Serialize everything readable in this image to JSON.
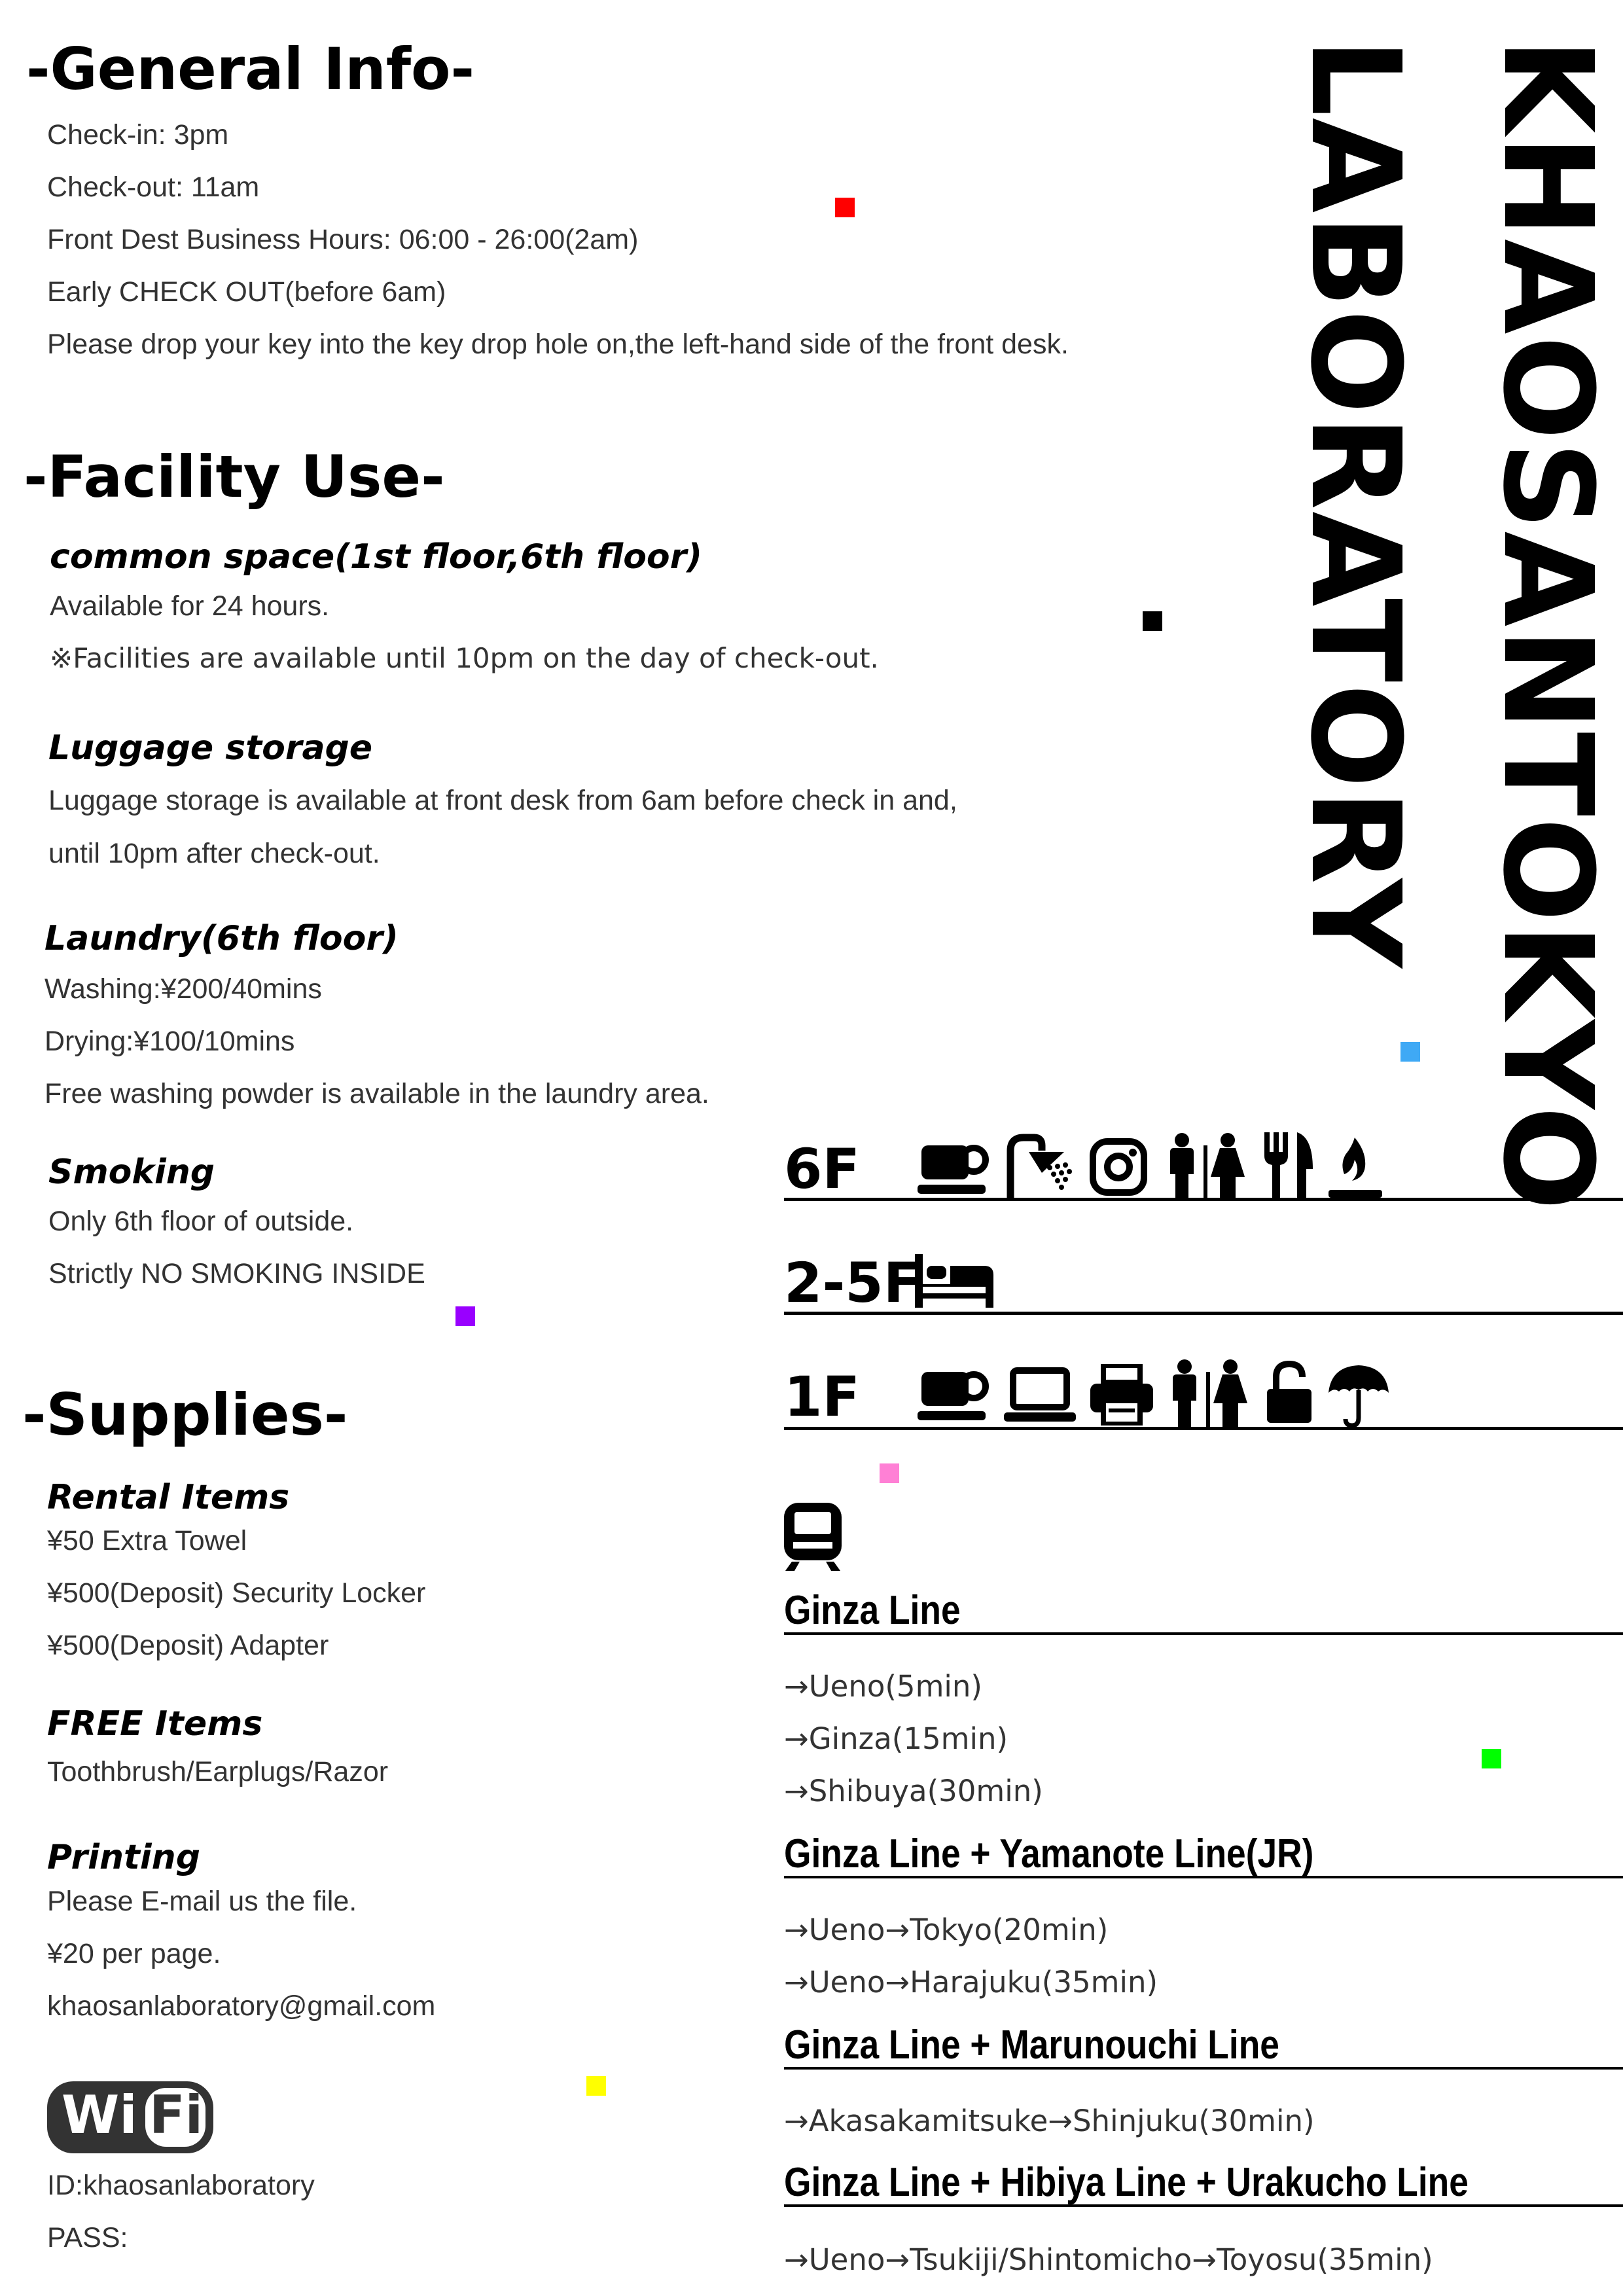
{
  "general": {
    "title": "-General Info-",
    "lines": [
      "Check-in: 3pm",
      "Check-out: 11am",
      "Front Dest Business Hours: 06:00 - 26:00(2am)",
      "Early CHECK OUT(before 6am)",
      "Please drop your key into the key drop hole on,the left-hand side of the front desk."
    ]
  },
  "facility": {
    "title": "-Facility Use-",
    "common": {
      "heading": "common space(1st floor,6th floor)",
      "lines": [
        "Available for 24 hours.",
        "※Facilities are available until 10pm on the day of check-out."
      ]
    },
    "luggage": {
      "heading": "Luggage storage",
      "lines": [
        "Luggage storage is available at front desk from 6am before check in and,",
        "until 10pm after check-out."
      ]
    },
    "laundry": {
      "heading": "Laundry(6th floor)",
      "lines": [
        "Washing:¥200/40mins",
        "Drying:¥100/10mins",
        "Free washing powder is available in the laundry area."
      ]
    },
    "smoking": {
      "heading": "Smoking",
      "lines": [
        "Only 6th floor of outside.",
        "Strictly NO SMOKING INSIDE"
      ]
    }
  },
  "supplies": {
    "title": "-Supplies-",
    "rental": {
      "heading": "Rental Items",
      "lines": [
        "¥50 Extra Towel",
        "¥500(Deposit) Security Locker",
        "¥500(Deposit) Adapter"
      ]
    },
    "free": {
      "heading": "FREE Items",
      "lines": [
        "Toothbrush/Earplugs/Razor"
      ]
    },
    "printing": {
      "heading": "Printing",
      "lines": [
        "Please E-mail us the file.",
        "¥20 per page.",
        "khaosanlaboratory@gmail.com"
      ]
    }
  },
  "wifi": {
    "logo_left": "Wi",
    "logo_right": "Fi",
    "id": "ID:khaosanlaboratory",
    "pass": "PASS:"
  },
  "brand": {
    "line1": "KHAOSANTOKYO",
    "line2": "LABORATORY"
  },
  "floors": [
    {
      "label": "6F",
      "icons": [
        "coffee-cup-icon",
        "shower-icon",
        "instagram-icon",
        "restroom-icon",
        "restaurant-icon",
        "smoking-icon"
      ]
    },
    {
      "label": "2-5F",
      "icons": [
        "bed-icon"
      ]
    },
    {
      "label": "1F",
      "icons": [
        "coffee-cup-icon",
        "laptop-icon",
        "printer-icon",
        "restroom-icon",
        "unlock-icon",
        "umbrella-icon"
      ]
    }
  ],
  "trains": {
    "icon": "train-icon",
    "routes": [
      {
        "line": "Ginza Line",
        "destinations": [
          "→Ueno(5min)",
          "→Ginza(15min)",
          "→Shibuya(30min)"
        ]
      },
      {
        "line": "Ginza Line + Yamanote Line(JR)",
        "destinations": [
          "→Ueno→Tokyo(20min)",
          "→Ueno→Harajuku(35min)"
        ]
      },
      {
        "line": "Ginza Line + Marunouchi Line",
        "destinations": [
          "→Akasakamitsuke→Shinjuku(30min)"
        ]
      },
      {
        "line": "Ginza Line + Hibiya Line + Urakucho Line",
        "destinations": [
          "→Ueno→Tsukiji/Shintomicho→Toyosu(35min)"
        ]
      }
    ]
  },
  "colors": {
    "red": "#ff0000",
    "black": "#000000",
    "blue": "#3fa9f5",
    "purple": "#9900ff",
    "pink": "#ff80d5",
    "green": "#00ff00",
    "yellow": "#ffff00"
  }
}
